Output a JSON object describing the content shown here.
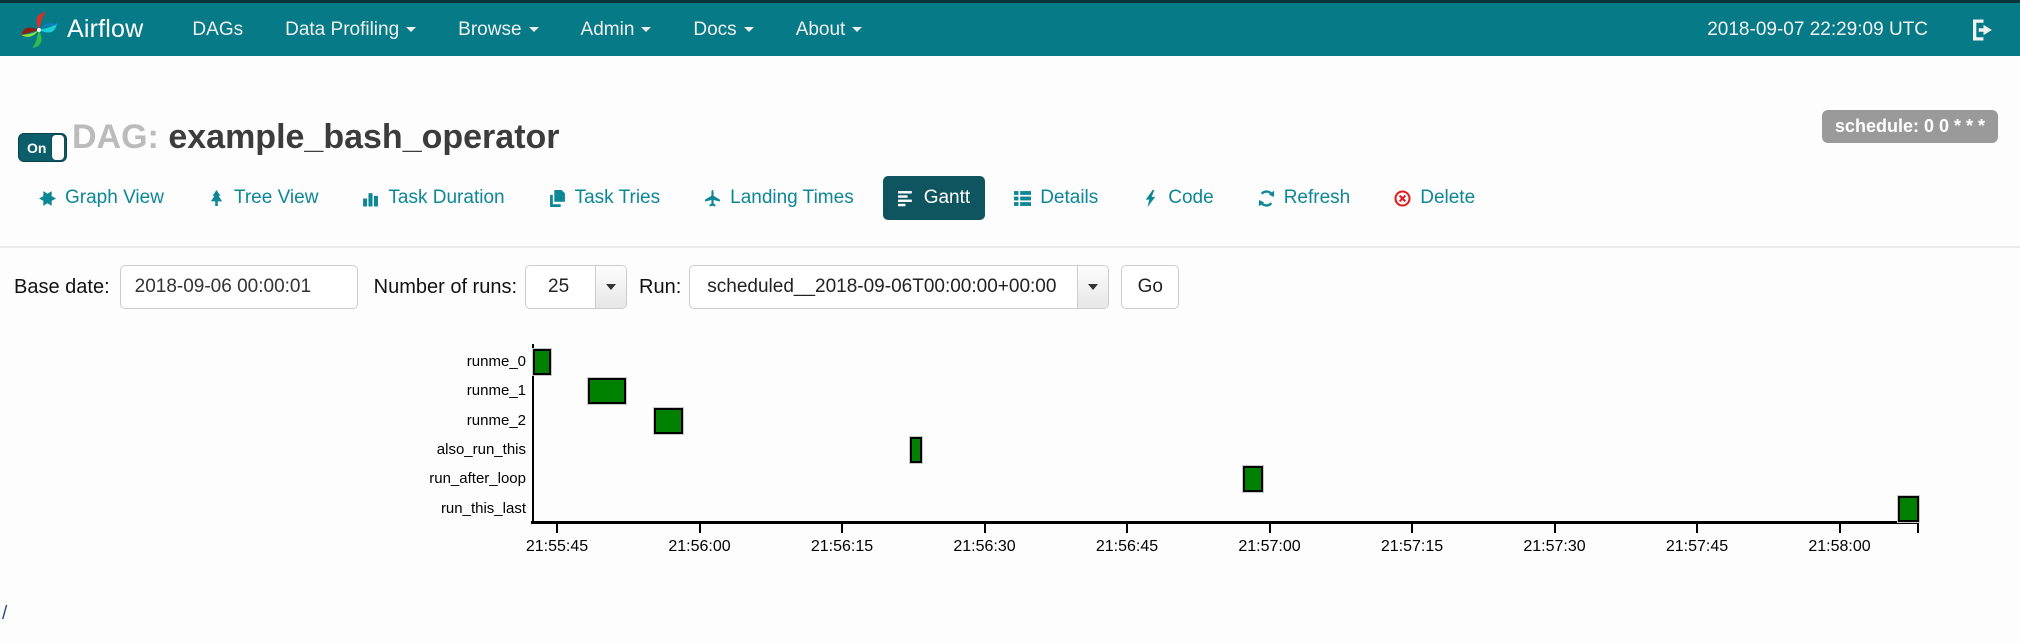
{
  "navbar": {
    "brand": "Airflow",
    "items": [
      {
        "label": "DAGs",
        "caret": false
      },
      {
        "label": "Data Profiling",
        "caret": true
      },
      {
        "label": "Browse",
        "caret": true
      },
      {
        "label": "Admin",
        "caret": true
      },
      {
        "label": "Docs",
        "caret": true
      },
      {
        "label": "About",
        "caret": true
      }
    ],
    "clock": "2018-09-07 22:29:09 UTC",
    "logout_icon": "sign-out-icon"
  },
  "dag_header": {
    "toggle_label": "On",
    "dag_prefix": "DAG:",
    "dag_name": "example_bash_operator",
    "schedule_badge": "schedule: 0 0 * * *",
    "badge_color": "#9a9a9a"
  },
  "tabs": [
    {
      "label": "Graph View",
      "icon": "certificate-icon",
      "active": false
    },
    {
      "label": "Tree View",
      "icon": "tree-icon",
      "active": false
    },
    {
      "label": "Task Duration",
      "icon": "bar-chart-icon",
      "active": false
    },
    {
      "label": "Task Tries",
      "icon": "duplicate-icon",
      "active": false
    },
    {
      "label": "Landing Times",
      "icon": "plane-icon",
      "active": false
    },
    {
      "label": "Gantt",
      "icon": "align-left-icon",
      "active": true
    },
    {
      "label": "Details",
      "icon": "th-list-icon",
      "active": false
    },
    {
      "label": "Code",
      "icon": "flash-icon",
      "active": false
    },
    {
      "label": "Refresh",
      "icon": "refresh-icon",
      "active": false
    },
    {
      "label": "Delete",
      "icon": "remove-circle-icon",
      "active": false,
      "danger": true
    }
  ],
  "controls": {
    "base_date_label": "Base date:",
    "base_date_value": "2018-09-06 00:00:01",
    "num_runs_label": "Number of runs:",
    "num_runs_value": "25",
    "run_label": "Run:",
    "run_value": "scheduled__2018-09-06T00:00:00+00:00",
    "go_label": "Go"
  },
  "chart_data": {
    "type": "gantt",
    "tasks": [
      "runme_0",
      "runme_1",
      "runme_2",
      "also_run_this",
      "run_after_loop",
      "run_this_last"
    ],
    "bars": [
      {
        "task": "runme_0",
        "start_s": -2.5,
        "end_s": -0.6
      },
      {
        "task": "runme_1",
        "start_s": 3.3,
        "end_s": 7.3
      },
      {
        "task": "runme_2",
        "start_s": 10.2,
        "end_s": 13.3
      },
      {
        "task": "also_run_this",
        "start_s": 37.2,
        "end_s": 38.4
      },
      {
        "task": "run_after_loop",
        "start_s": 72.2,
        "end_s": 74.3
      },
      {
        "task": "run_this_last",
        "start_s": 141.2,
        "end_s": 143.4
      }
    ],
    "time_origin_label": "21:55:45",
    "x_ticks": [
      "21:55:45",
      "21:56:00",
      "21:56:15",
      "21:56:30",
      "21:56:45",
      "21:57:00",
      "21:57:15",
      "21:57:30",
      "21:57:45",
      "21:58:00"
    ],
    "tick_interval_s": 15,
    "bar_color": "#008000",
    "bar_border_color": "#000000",
    "status_color_meaning": "success"
  },
  "footer": {
    "root_link": "/"
  },
  "theme": {
    "navbar_bg": "#077a87",
    "active_tab_bg": "#0f5560",
    "link_teal": "#0d8796",
    "delete_red": "#e11b1b"
  }
}
